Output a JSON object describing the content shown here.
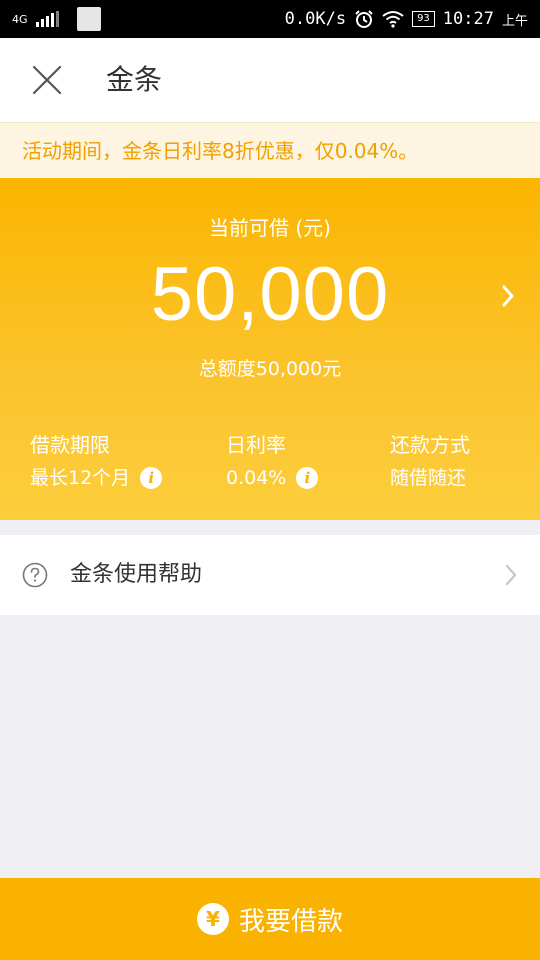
{
  "status_bar": {
    "network": "4G",
    "speed": "0.0K/s",
    "battery": "93",
    "time": "10:27",
    "ampm": "上午",
    "icons": [
      "signal-icon",
      "alarm-icon",
      "wifi-icon",
      "battery-icon"
    ]
  },
  "header": {
    "title": "金条",
    "close_icon": "close-icon"
  },
  "notice": {
    "text": "活动期间，金条日利率8折优惠，仅0.04%。"
  },
  "hero": {
    "caption": "当前可借 (元)",
    "amount": "50,000",
    "total": "总额度50,000元",
    "stats": [
      {
        "label": "借款期限",
        "value": "最长12个月",
        "info": true
      },
      {
        "label": "日利率",
        "value": "0.04%",
        "info": true
      },
      {
        "label": "还款方式",
        "value": "随借随还",
        "info": false
      }
    ]
  },
  "help": {
    "label": "金条使用帮助"
  },
  "borrow_button": {
    "icon_glyph": "¥",
    "label": "我要借款"
  },
  "colors": {
    "accent": "#fab200",
    "notice_text": "#f0a000",
    "notice_bg": "#fdf4e2",
    "page_bg": "#efeff4"
  }
}
